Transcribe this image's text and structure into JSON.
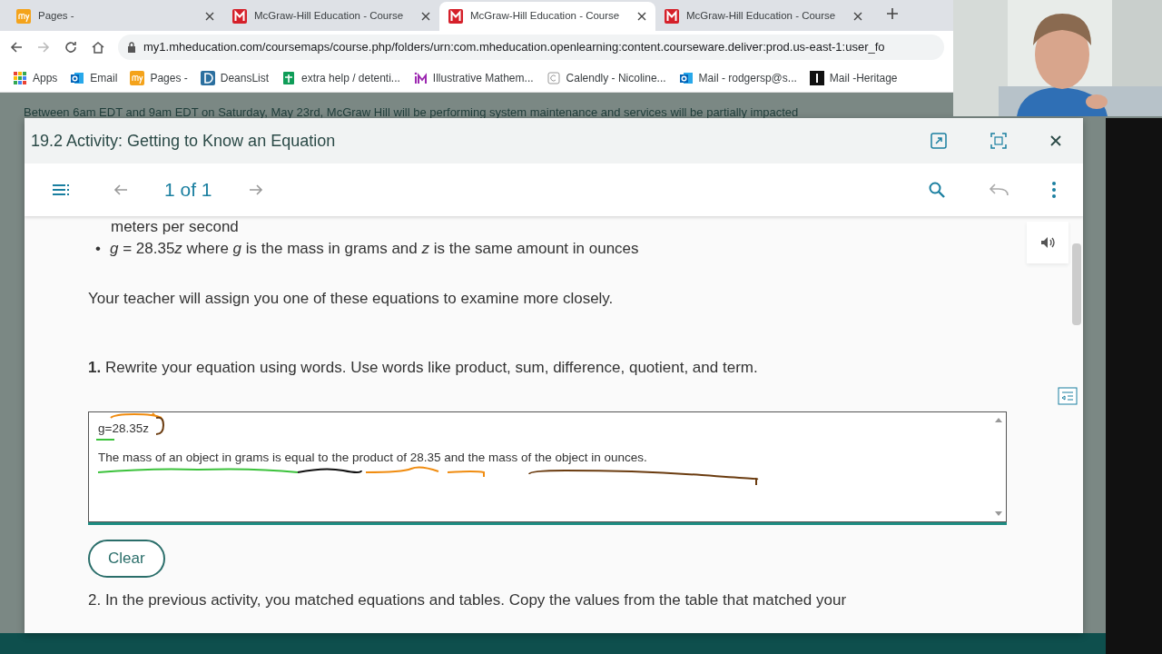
{
  "browser": {
    "tabs": [
      {
        "title": "Pages -",
        "selected": false
      },
      {
        "title": "McGraw-Hill Education - Course",
        "selected": false
      },
      {
        "title": "McGraw-Hill Education - Course",
        "selected": true
      },
      {
        "title": "McGraw-Hill Education - Course",
        "selected": false
      }
    ],
    "url": "my1.mheducation.com/coursemaps/course.php/folders/urn:com.mheducation.openlearning:content.courseware.deliver:prod.us-east-1:user_fo",
    "bookmarks": [
      "Apps",
      "Email",
      "Pages -",
      "DeansList",
      "extra help / detenti...",
      "Illustrative Mathem...",
      "Calendly - Nicoline...",
      "Mail - rodgersp@s...",
      "Mail -Heritage"
    ]
  },
  "banner": "Between 6am EDT and 9am EDT on Saturday, May 23rd, McGraw Hill will be performing system maintenance and services will be partially impacted",
  "modal": {
    "title": "19.2 Activity: Getting to Know an Equation",
    "pager": "1 of 1",
    "bullet_tail": "meters per second",
    "bullets": [
      {
        "marker": "•",
        "parts": [
          {
            "text": "g",
            "italic": true
          },
          {
            "text": " = 28.35",
            "italic": false
          },
          {
            "text": "z",
            "italic": true
          },
          {
            "text": " where ",
            "italic": false
          },
          {
            "text": "g",
            "italic": true
          },
          {
            "text": " is the mass in grams and ",
            "italic": false
          },
          {
            "text": "z",
            "italic": true
          },
          {
            "text": " is the same amount in ounces",
            "italic": false
          }
        ]
      }
    ],
    "intro": "Your teacher will assign you one of these equations to examine more closely.",
    "question": {
      "number": "1.",
      "text": "Rewrite your equation using words. Use words like product, sum, difference, quotient, and term."
    },
    "answer_lines": [
      "g=28.35z",
      "The mass of an object in grams is equal to the product of 28.35 and the mass of the object in ounces."
    ],
    "clear_button": "Clear",
    "next_question": "2. In the previous activity, you matched equations and tables. Copy the values from the table that matched your"
  }
}
